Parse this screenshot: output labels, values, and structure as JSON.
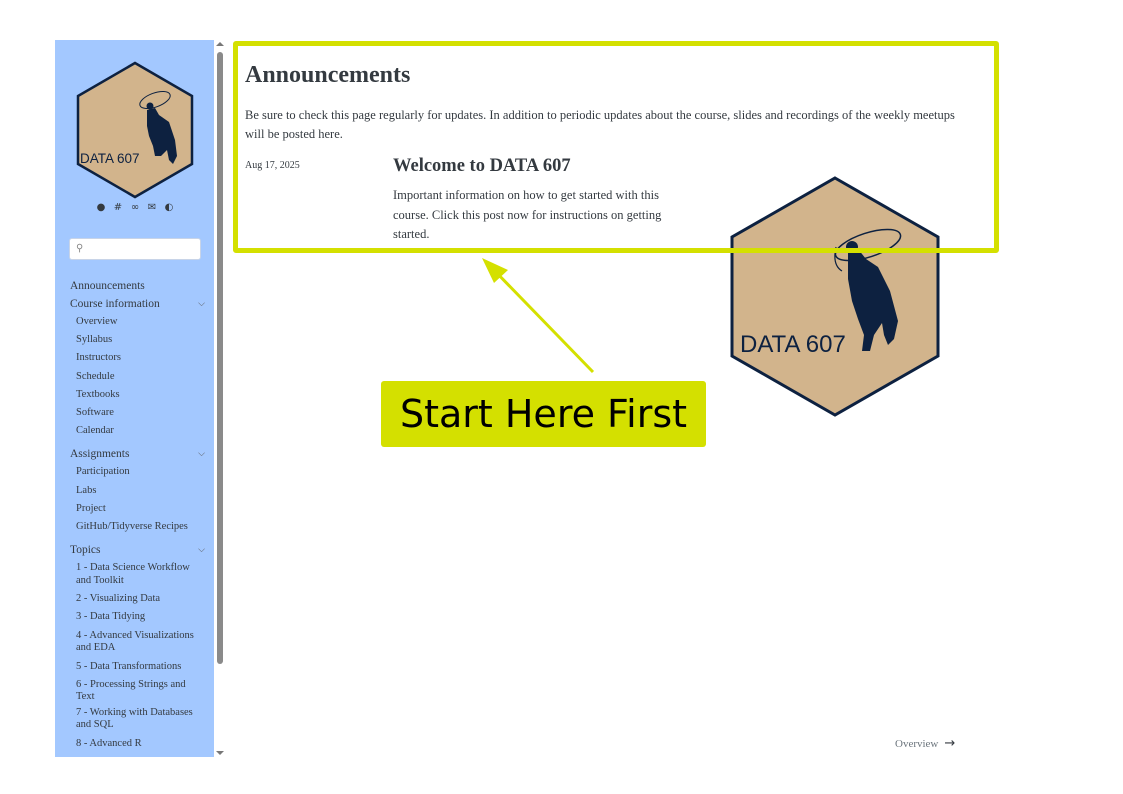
{
  "sidebar": {
    "logo_text": "DATA 607",
    "tools": [
      "github-icon",
      "slack-icon",
      "link-icon",
      "mail-icon",
      "toggle-icon"
    ],
    "search": {
      "placeholder": ""
    },
    "nav": [
      {
        "label": "Announcements"
      },
      {
        "label": "Course information",
        "children": [
          "Overview",
          "Syllabus",
          "Instructors",
          "Schedule",
          "Textbooks",
          "Software",
          "Calendar"
        ]
      },
      {
        "label": "Assignments",
        "children": [
          "Participation",
          "Labs",
          "Project",
          "GitHub/Tidyverse Recipes"
        ]
      },
      {
        "label": "Topics",
        "children": [
          "1 - Data Science Workflow and Toolkit",
          "2 - Visualizing Data",
          "3 - Data Tidying",
          "4 - Advanced Visualizations and EDA",
          "5 - Data Transformations",
          "6 - Processing Strings and Text",
          "7 - Working with Databases and SQL",
          "8 - Advanced R"
        ]
      }
    ]
  },
  "main": {
    "title": "Announcements",
    "intro": "Be sure to check this page regularly for updates. In addition to periodic updates about the course, slides and recordings of the weekly meetups will be posted here.",
    "post": {
      "date": "Aug 17, 2025",
      "title": "Welcome to DATA 607",
      "description": "Important information on how to get started with this course. Click this post now for instructions on getting started."
    },
    "logo_text": "DATA 607",
    "next_label": "Overview"
  },
  "annotation": {
    "callout": "Start Here First",
    "color": "#d4e000"
  },
  "colors": {
    "sidebar_bg": "#a3c8ff",
    "logo_fill": "#d2b48c",
    "logo_stroke": "#0d2140"
  }
}
